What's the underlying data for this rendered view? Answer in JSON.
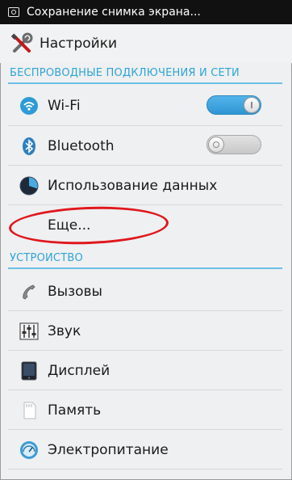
{
  "status_bar": {
    "notification_text": "Сохранение снимка экрана...",
    "icon": "screenshot-icon"
  },
  "action_bar": {
    "title": "Настройки",
    "icon": "settings-tools-icon"
  },
  "sections": [
    {
      "header": "БЕСПРОВОДНЫЕ ПОДКЛЮЧЕНИЯ И СЕТИ",
      "items": [
        {
          "label": "Wi-Fi",
          "icon": "wifi-icon",
          "toggle": true,
          "toggle_state": "on"
        },
        {
          "label": "Bluetooth",
          "icon": "bluetooth-icon",
          "toggle": true,
          "toggle_state": "off"
        },
        {
          "label": "Использование данных",
          "icon": "data-usage-icon"
        },
        {
          "label": "Еще...",
          "icon": "",
          "highlighted": true
        }
      ]
    },
    {
      "header": "УСТРОЙСТВО",
      "items": [
        {
          "label": "Вызовы",
          "icon": "phone-icon"
        },
        {
          "label": "Звук",
          "icon": "sound-equalizer-icon"
        },
        {
          "label": "Дисплей",
          "icon": "display-icon"
        },
        {
          "label": "Память",
          "icon": "storage-icon"
        },
        {
          "label": "Электропитание",
          "icon": "power-gauge-icon"
        }
      ]
    }
  ],
  "colors": {
    "accent": "#2fa3d8",
    "highlight": "#e0171d",
    "toggle_on": "#3aa3e0"
  }
}
